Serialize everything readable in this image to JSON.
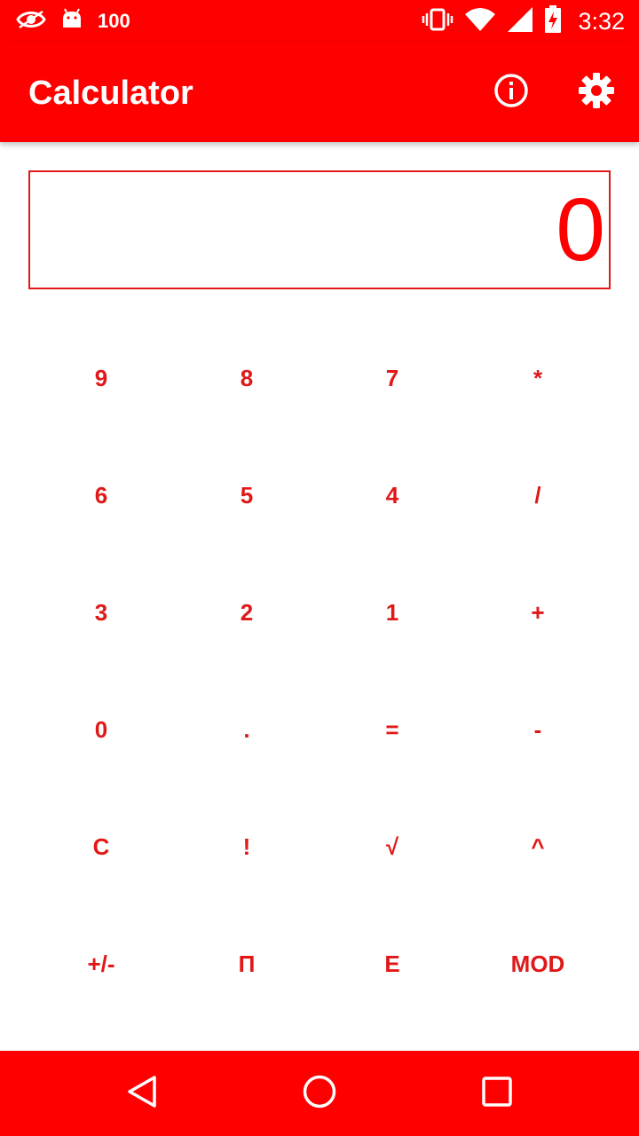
{
  "status_bar": {
    "notification_count": "100",
    "time": "3:32",
    "icons": [
      "eye-notification-icon",
      "android-notification-icon",
      "vibrate-icon",
      "wifi-icon",
      "signal-icon",
      "battery-charging-icon"
    ]
  },
  "app_bar": {
    "title": "Calculator",
    "actions": [
      "info-icon",
      "settings-gear-icon"
    ]
  },
  "display": {
    "value": "0"
  },
  "keypad": {
    "keys": [
      [
        "9",
        "8",
        "7",
        "*"
      ],
      [
        "6",
        "5",
        "4",
        "/"
      ],
      [
        "3",
        "2",
        "1",
        "+"
      ],
      [
        "0",
        ".",
        "=",
        "-"
      ],
      [
        "C",
        "!",
        "√",
        "^"
      ],
      [
        "+/-",
        "Π",
        "E",
        "MOD"
      ]
    ]
  },
  "nav_bar": {
    "buttons": [
      "back-icon",
      "home-icon",
      "recents-icon"
    ]
  },
  "colors": {
    "primary": "#ff0000",
    "key_text": "#e01818",
    "background": "#ffffff"
  }
}
